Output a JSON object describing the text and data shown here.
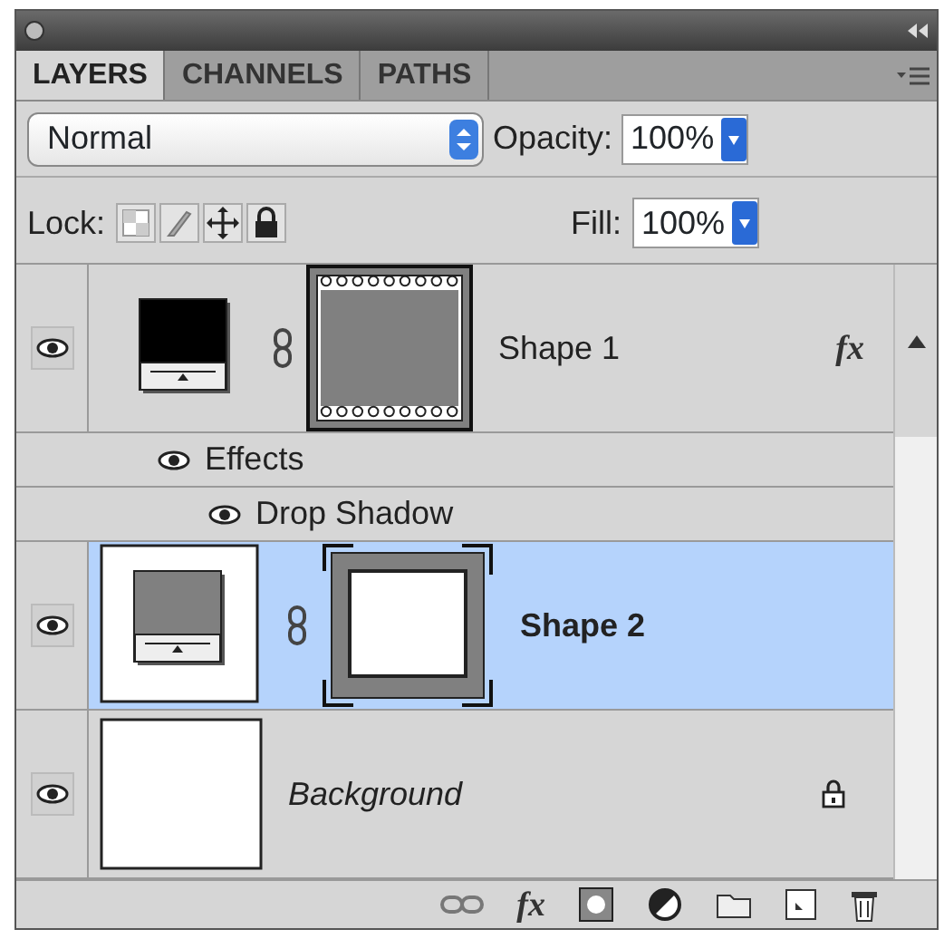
{
  "tabs": [
    {
      "label": "LAYERS",
      "selected": true
    },
    {
      "label": "CHANNELS",
      "selected": false
    },
    {
      "label": "PATHS",
      "selected": false
    }
  ],
  "blend_mode": "Normal",
  "opacity_label": "Opacity:",
  "opacity": "100%",
  "lock_label": "Lock:",
  "locks": [
    {
      "kind": "transparency"
    },
    {
      "kind": "paint"
    },
    {
      "kind": "move"
    },
    {
      "kind": "all"
    }
  ],
  "fill_label": "Fill:",
  "fill": "100%",
  "layers": [
    {
      "name": "Shape 1",
      "kind": "shape",
      "color": "#000000",
      "selected": false,
      "visible": true,
      "effects_badge": "fx",
      "locked": false,
      "children": [
        {
          "name": "Effects",
          "visible": true,
          "children": [
            {
              "name": "Drop Shadow",
              "visible": true
            }
          ]
        }
      ]
    },
    {
      "name": "Shape 2",
      "kind": "shape",
      "color": "#808080",
      "selected": true,
      "visible": true,
      "locked": false
    },
    {
      "name": "Background",
      "kind": "background",
      "selected": false,
      "visible": true,
      "locked": true
    }
  ],
  "footer_effects_label": "fx"
}
